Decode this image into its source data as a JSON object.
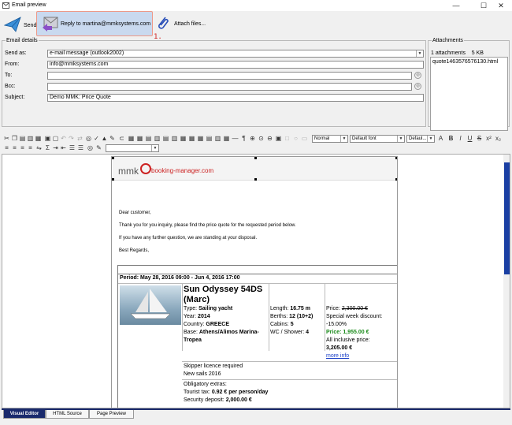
{
  "window": {
    "title": "Email preview",
    "minimize": "—",
    "maximize": "☐",
    "close": "✕"
  },
  "toolbar": {
    "send_label": "Send",
    "reply_label": "Reply to martina@mmksystems.com",
    "attach_label": "Attach files...",
    "step_marker": "1."
  },
  "details": {
    "legend": "Email details",
    "send_as_label": "Send as:",
    "send_as_value": "e-mail message (outlook2002)",
    "from_label": "From:",
    "from_value": "info@mmksystems.com",
    "to_label": "To:",
    "to_value": "",
    "bcc_label": "Bcc:",
    "bcc_value": "",
    "subject_label": "Subject:",
    "subject_value": "Demo MMK: Price Quote"
  },
  "attachments": {
    "legend": "Attachments",
    "count": "1 attachments",
    "size": "5 KB",
    "files": [
      "quote1463576576130.html"
    ]
  },
  "format_bar": {
    "style": "Normal",
    "font": "Default font",
    "size": "Defaul..."
  },
  "email": {
    "logo_mmk": "mmk",
    "logo_text": "booking-manager.com",
    "greeting": "Dear customer,",
    "line1": "Thank you for you inquiry, please find the price quote for the requested period below.",
    "line2": "If you have any further question, we are standing at your disposal.",
    "closing": "Best Regards,",
    "period": "Period: May 28, 2016 09:00 - Jun 4, 2016 17:00",
    "yacht_name": "Sun Odyssey 54DS (Marc)",
    "type_label": "Type:",
    "type_value": "Sailing yacht",
    "year_label": "Year:",
    "year_value": "2014",
    "country_label": "Country:",
    "country_value": "GREECE",
    "base_label": "Base:",
    "base_value": "Athens/Alimos Marina-Tropea",
    "length_label": "Length:",
    "length_value": "16.75 m",
    "berths_label": "Berths:",
    "berths_value": "12 (10+2)",
    "cabins_label": "Cabins:",
    "cabins_value": "5",
    "wc_label": "WC / Shower:",
    "wc_value": "4",
    "price_label": "Price:",
    "price_old": "2,300.00 €",
    "discount_label": "Special week discount:",
    "discount_value": "-15.00%",
    "price_new": "Price: 1,955.00 €",
    "all_incl_label": "All inclusive price:",
    "all_incl_value": "3,205.00 €",
    "more_info": "more info",
    "skipper": "Skipper licence required",
    "new_sails": "New sails 2016",
    "extras_label": "Obligatory extras:",
    "tourist_tax_label": "Tourist tax:",
    "tourist_tax_value": "0.92 € per person/day",
    "deposit_label": "Security deposit:",
    "deposit_value": "2,000.00 €"
  },
  "tabs": [
    "Visual Editor",
    "HTML Source",
    "Page Preview"
  ],
  "colors": {
    "accent": "#1a2a6c",
    "reply_bg": "#c9d9ef",
    "logo_red": "#cc2222",
    "price_green": "#1a8a1a",
    "scroll_blue": "#1a3fa3"
  }
}
